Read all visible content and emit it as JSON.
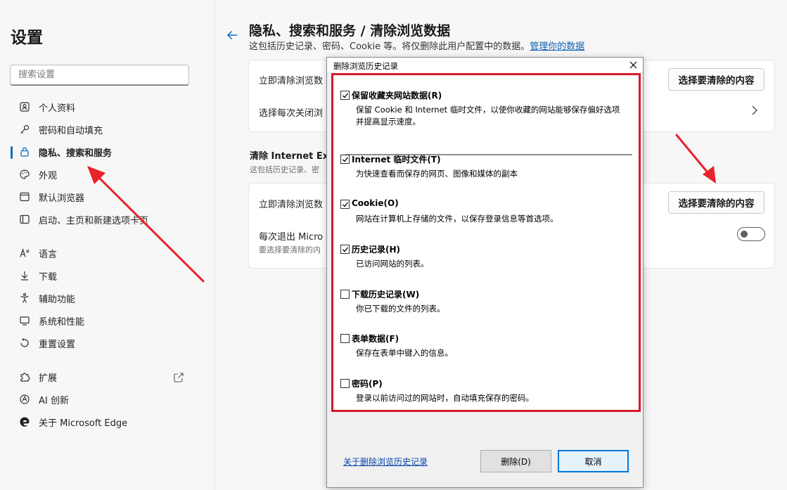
{
  "sidebar": {
    "title": "设置",
    "search_placeholder": "搜索设置",
    "items": [
      {
        "label": "个人资料",
        "icon": "profile-icon"
      },
      {
        "label": "密码和自动填充",
        "icon": "key-icon"
      },
      {
        "label": "隐私、搜索和服务",
        "icon": "lock-icon",
        "active": true
      },
      {
        "label": "外观",
        "icon": "palette-icon"
      },
      {
        "label": "默认浏览器",
        "icon": "browser-icon"
      },
      {
        "label": "启动、主页和新建选项卡页",
        "icon": "home-tab-icon"
      },
      {
        "label": "语言",
        "icon": "language-icon"
      },
      {
        "label": "下载",
        "icon": "download-icon"
      },
      {
        "label": "辅助功能",
        "icon": "accessibility-icon"
      },
      {
        "label": "系统和性能",
        "icon": "system-icon"
      },
      {
        "label": "重置设置",
        "icon": "reset-icon"
      },
      {
        "label": "扩展",
        "icon": "extensions-icon"
      },
      {
        "label": "AI 创新",
        "icon": "ai-icon"
      },
      {
        "label": "关于 Microsoft Edge",
        "icon": "edge-logo-icon"
      }
    ]
  },
  "main": {
    "title": "隐私、搜索和服务 / 清除浏览数据",
    "desc_prefix": "这包括历史记录、密码、Cookie 等。将仅删除此用户配置中的数据。",
    "desc_link": "管理你的数据",
    "card1": {
      "row1": "立即清除浏览数",
      "row1_button": "选择要清除的内容",
      "row2": "选择每次关闭浏"
    },
    "section2_title": "清除 Internet Expl",
    "section2_desc": "这包括历史记录、密",
    "card2": {
      "row1": "立即清除浏览数",
      "row1_button": "选择要清除的内容",
      "row2": "每次退出 Micro",
      "row2_sub": "要选择要清除的内"
    }
  },
  "dialog": {
    "title": "删除浏览历史记录",
    "options": [
      {
        "label": "保留收藏夹网站数据(R)",
        "desc": "保留 Cookie 和 Internet 临时文件，以使你收藏的网站能够保存偏好选项并提高显示速度。",
        "checked": true
      },
      {
        "label": "Internet 临时文件(T)",
        "desc": "为快速查看而保存的网页、图像和媒体的副本",
        "checked": true
      },
      {
        "label": "Cookie(O)",
        "desc": "网站在计算机上存储的文件，以保存登录信息等首选项。",
        "checked": true
      },
      {
        "label": "历史记录(H)",
        "desc": "已访问网站的列表。",
        "checked": true
      },
      {
        "label": "下载历史记录(W)",
        "desc": "你已下载的文件的列表。",
        "checked": false
      },
      {
        "label": "表单数据(F)",
        "desc": "保存在表单中键入的信息。",
        "checked": false
      },
      {
        "label": "密码(P)",
        "desc": "登录以前访问过的网站时，自动填充保存的密码。",
        "checked": false
      }
    ],
    "link": "关于删除浏览历史记录",
    "delete_button": "删除(D)",
    "cancel_button": "取消"
  },
  "colors": {
    "accent": "#0f6cbd",
    "highlight_border": "#d7192c",
    "arrow": "#e8232b",
    "link": "#0645ad"
  }
}
